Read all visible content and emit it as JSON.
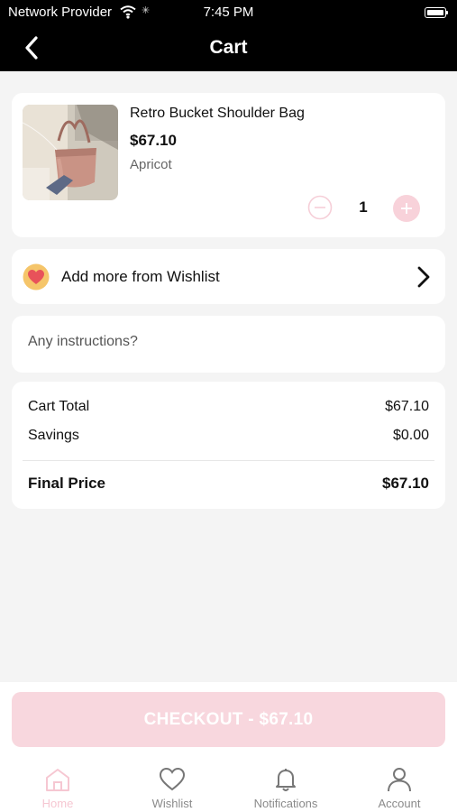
{
  "status_bar": {
    "carrier": "Network Provider",
    "time": "7:45 PM"
  },
  "nav": {
    "title": "Cart"
  },
  "product": {
    "name": "Retro Bucket Shoulder Bag",
    "price": "$67.10",
    "variant": "Apricot",
    "quantity": "1",
    "image_icon": "handbag-photo"
  },
  "wishlist": {
    "label": "Add more from Wishlist"
  },
  "instructions": {
    "placeholder": "Any instructions?",
    "value": ""
  },
  "summary": {
    "cart_total_label": "Cart Total",
    "cart_total_value": "$67.10",
    "savings_label": "Savings",
    "savings_value": "$0.00",
    "final_label": "Final Price",
    "final_value": "$67.10"
  },
  "checkout": {
    "label": "CHECKOUT - $67.10"
  },
  "tabs": [
    {
      "label": "Home",
      "icon": "home-icon",
      "active": true
    },
    {
      "label": "Wishlist",
      "icon": "heart-icon",
      "active": false
    },
    {
      "label": "Notifications",
      "icon": "bell-icon",
      "active": false
    },
    {
      "label": "Account",
      "icon": "user-icon",
      "active": false
    }
  ],
  "colors": {
    "accent_pink": "#f8d7de",
    "header_bg": "#000000",
    "page_bg": "#f4f4f4",
    "wishlist_heart_bg": "#f5c56a",
    "wishlist_heart": "#e8525a"
  }
}
